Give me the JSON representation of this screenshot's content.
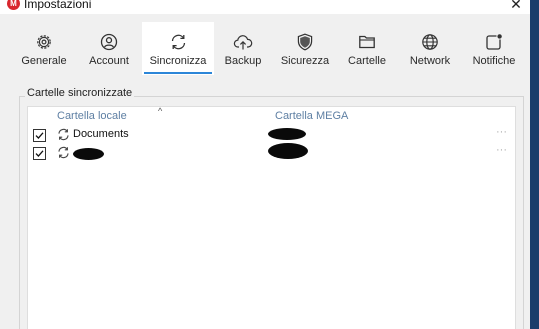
{
  "window": {
    "title": "Impostazioni",
    "logo_letter": "M",
    "close_glyph": "✕"
  },
  "tabs": [
    {
      "label": "Generale",
      "icon": "gear-icon",
      "active": false
    },
    {
      "label": "Account",
      "icon": "user-icon",
      "active": false
    },
    {
      "label": "Sincronizza",
      "icon": "sync-icon",
      "active": true
    },
    {
      "label": "Backup",
      "icon": "cloud-upload-icon",
      "active": false
    },
    {
      "label": "Sicurezza",
      "icon": "shield-icon",
      "active": false
    },
    {
      "label": "Cartelle",
      "icon": "folder-icon",
      "active": false
    },
    {
      "label": "Network",
      "icon": "globe-icon",
      "active": false
    },
    {
      "label": "Notifiche",
      "icon": "notification-icon",
      "active": false
    }
  ],
  "sync": {
    "group_title": "Cartelle sincronizzate",
    "columns": {
      "local": "Cartella locale",
      "mega": "Cartella MEGA"
    },
    "sort_glyph": "^",
    "rows": [
      {
        "checked": true,
        "local_name": "Documents",
        "mega_name": "",
        "menu": "···"
      },
      {
        "checked": true,
        "local_name": "",
        "mega_name": "",
        "menu": "···"
      }
    ]
  },
  "colors": {
    "accent": "#2c86d8",
    "brand": "#d9272e",
    "header_text": "#5e7fa3"
  }
}
